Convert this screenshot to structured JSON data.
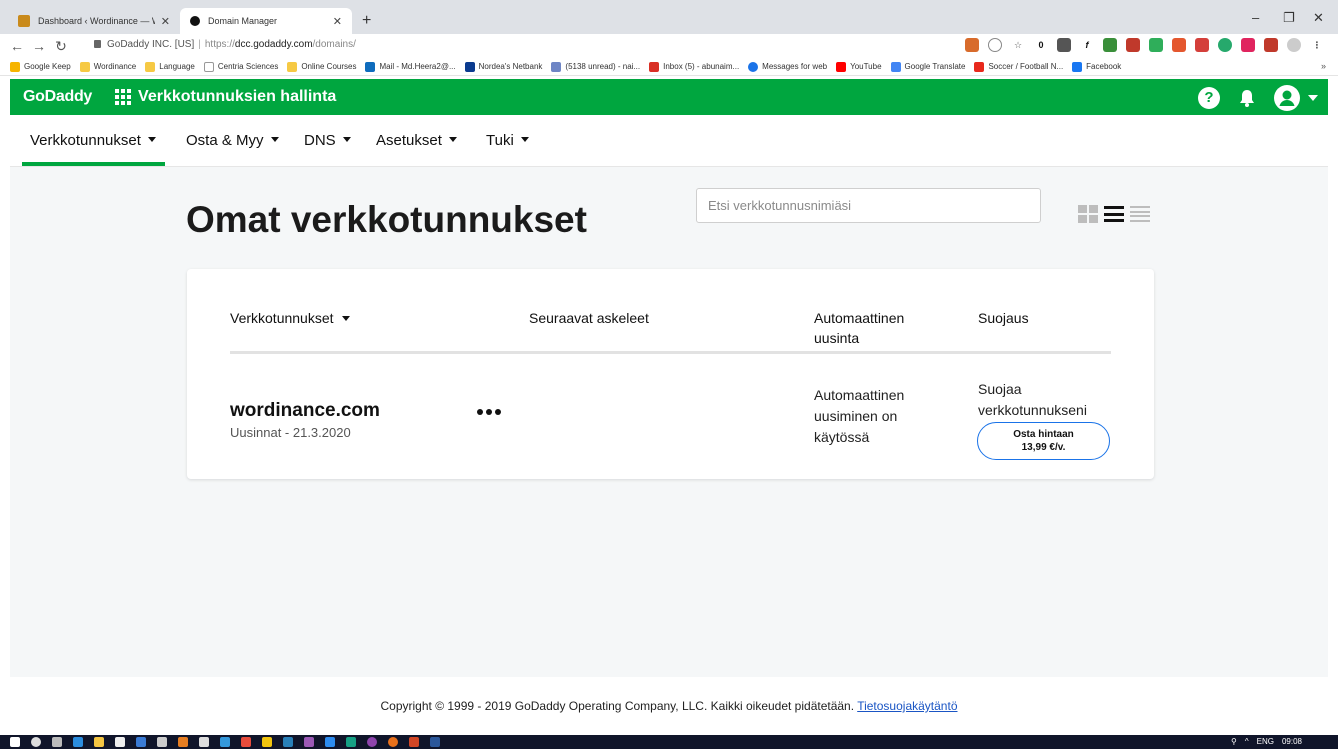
{
  "browser": {
    "tabs": [
      {
        "title": "Dashboard ‹ Wordinance — Wor",
        "active": false
      },
      {
        "title": "Domain Manager",
        "active": true
      }
    ],
    "url": {
      "site_label": "GoDaddy INC. [US]",
      "scheme": "https://",
      "host": "dcc.godaddy.com",
      "path": "/domains/"
    },
    "counter_badge": "0",
    "bookmarks": [
      {
        "label": "Google Keep",
        "color": "#f6b400"
      },
      {
        "label": "Wordinance",
        "color": "#f6c944"
      },
      {
        "label": "Language",
        "color": "#f6c944"
      },
      {
        "label": "Centria Sciences",
        "color": "#dddddd"
      },
      {
        "label": "Online Courses",
        "color": "#f6c944"
      },
      {
        "label": "Mail - Md.Heera2@...",
        "color": "#0f6cbd"
      },
      {
        "label": "Nordea's Netbank",
        "color": "#0b3b8f"
      },
      {
        "label": "(5138 unread) - nai...",
        "color": "#6e85c5"
      },
      {
        "label": "Inbox (5) - abunaim...",
        "color": "#d93025"
      },
      {
        "label": "Messages for web",
        "color": "#1a73e8"
      },
      {
        "label": "YouTube",
        "color": "#ff0000"
      },
      {
        "label": "Google Translate",
        "color": "#4285f4"
      },
      {
        "label": "Soccer / Football N...",
        "color": "#e8291c"
      },
      {
        "label": "Facebook",
        "color": "#1877f2"
      }
    ],
    "bookmarks_more": "»"
  },
  "header": {
    "logo": "GoDaddy",
    "title": "Verkkotunnuksien hallinta",
    "help_glyph": "?"
  },
  "subnav": [
    {
      "label": "Verkkotunnukset",
      "active": true
    },
    {
      "label": "Osta & Myy"
    },
    {
      "label": "DNS"
    },
    {
      "label": "Asetukset"
    },
    {
      "label": "Tuki"
    }
  ],
  "main": {
    "title": "Omat verkkotunnukset",
    "search_placeholder": "Etsi verkkotunnusnimiäsi"
  },
  "table": {
    "headers": {
      "domains": "Verkkotunnukset",
      "next_steps": "Seuraavat askeleet",
      "auto_renew": "Automaattinen uusinta",
      "protection": "Suojaus"
    },
    "rows": [
      {
        "domain": "wordinance.com",
        "renewal": "Uusinnat - 21.3.2020",
        "more": "•••",
        "auto_renew": "Automaattinen uusiminen on käytössä",
        "protection_text": "Suojaa verkkotunnukseni",
        "buy_label_line1": "Osta hintaan",
        "buy_label_line2": "13,99 €/v."
      }
    ]
  },
  "footer": {
    "copyright": "Copyright © 1999 - 2019 GoDaddy Operating Company, LLC. Kaikki oikeudet pidätetään.",
    "privacy_link": "Tietosuojakäytäntö"
  },
  "taskbar": {
    "lang": "ENG",
    "time": "09:08"
  },
  "colors": {
    "brand_green": "#00a63f",
    "link_blue": "#1a55c4",
    "button_border": "#1a73e8"
  }
}
